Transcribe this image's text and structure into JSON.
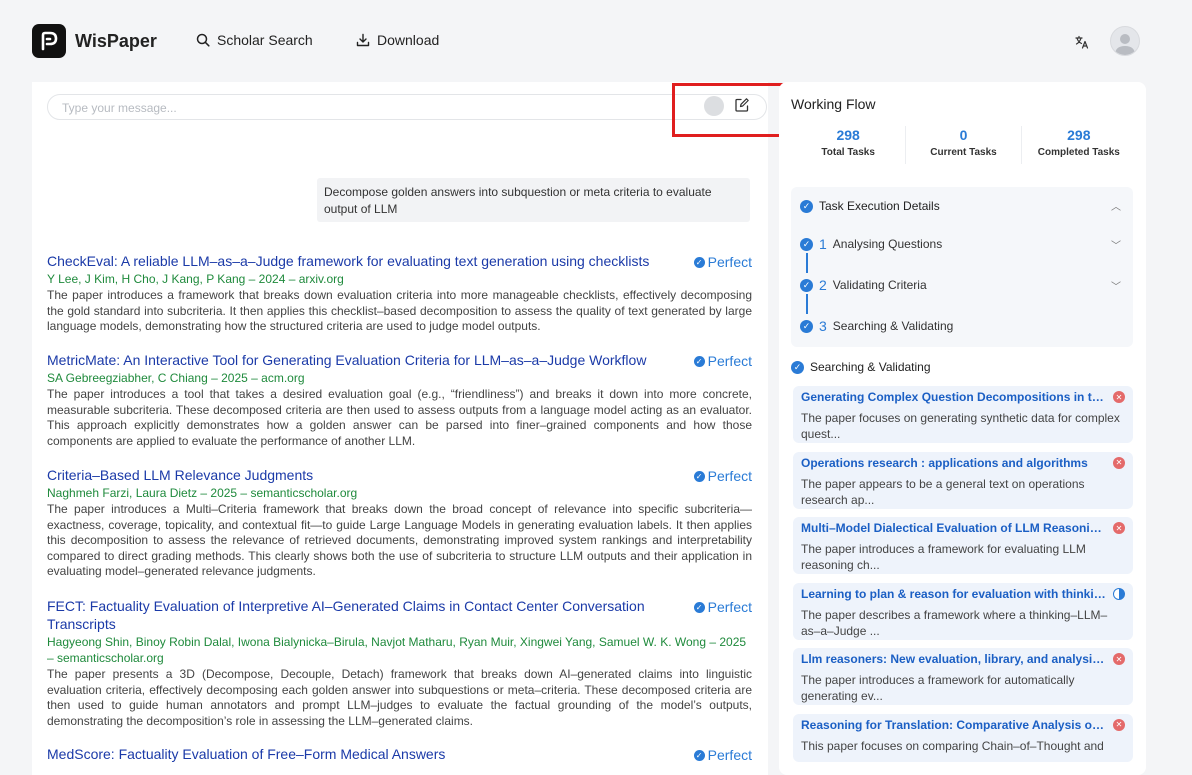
{
  "header": {
    "app_name": "WisPaper",
    "nav": [
      {
        "label": "Scholar Search",
        "icon": "search-icon"
      },
      {
        "label": "Download",
        "icon": "download-icon"
      }
    ],
    "translate_icon": "translate-icon",
    "avatar_icon": "user-avatar-icon"
  },
  "chat": {
    "input_placeholder": "Type your message...",
    "input_value": "",
    "query": "Decompose golden answers into subquestion or meta criteria to evaluate output of LLM"
  },
  "results": [
    {
      "title": "CheckEval: A reliable LLM–as–a–Judge framework for evaluating text generation using checklists",
      "meta": "Y Lee, J Kim, H Cho, J Kang, P Kang – 2024 – arxiv.org",
      "abstract": "The paper introduces a framework that breaks down evaluation criteria into more manageable checklists, effectively decomposing the gold standard into subcriteria. It then applies this checklist–based decomposition to assess the quality of text generated by large language models, demonstrating how the structured criteria are used to judge model outputs.",
      "badge": "Perfect"
    },
    {
      "title": "MetricMate: An Interactive Tool for Generating Evaluation Criteria for LLM–as–a–Judge Workflow",
      "meta": "SA Gebreegziabher, C Chiang – 2025 – acm.org",
      "abstract": "The paper introduces a tool that takes a desired evaluation goal (e.g., “friendliness”) and breaks it down into more concrete, measurable subcriteria. These decomposed criteria are then used to assess outputs from a language model acting as an evaluator. This approach explicitly demonstrates how a golden answer can be parsed into finer–grained components and how those components are applied to evaluate the performance of another LLM.",
      "badge": "Perfect"
    },
    {
      "title": "Criteria–Based LLM Relevance Judgments",
      "meta": "Naghmeh Farzi, Laura Dietz – 2025 – semanticscholar.org",
      "abstract": "The paper introduces a Multi–Criteria framework that breaks down the broad concept of relevance into specific subcriteria—exactness, coverage, topicality, and contextual fit—to guide Large Language Models in generating evaluation labels. It then applies this decomposition to assess the relevance of retrieved documents, demonstrating improved system rankings and interpretability compared to direct grading methods. This clearly shows both the use of subcriteria to structure LLM outputs and their application in evaluating model–generated relevance judgments.",
      "badge": "Perfect"
    },
    {
      "title": "FECT: Factuality Evaluation of Interpretive AI–Generated Claims in Contact Center Conversation Transcripts",
      "meta": "Hagyeong Shin, Binoy Robin Dalal, Iwona Bialynicka–Birula, Navjot Matharu, Ryan Muir, Xingwei Yang, Samuel W. K. Wong – 2025 – semanticscholar.org",
      "abstract": "The paper presents a 3D (Decompose, Decouple, Detach) framework that breaks down AI–generated claims into linguistic evaluation criteria, effectively decomposing each golden answer into subquestions or meta–criteria. These decomposed criteria are then used to guide human annotators and prompt LLM–judges to evaluate the factual grounding of the model’s outputs, demonstrating the decomposition’s role in assessing the LLM–generated claims.",
      "badge": "Perfect"
    },
    {
      "title": "MedScore: Factuality Evaluation of Free–Form Medical Answers",
      "meta": "",
      "abstract": "",
      "badge": "Perfect"
    }
  ],
  "workflow": {
    "title": "Working Flow",
    "stats": [
      {
        "value": "298",
        "label": "Total Tasks"
      },
      {
        "value": "0",
        "label": "Current Tasks"
      },
      {
        "value": "298",
        "label": "Completed Tasks"
      }
    ],
    "details_title": "Task Execution Details",
    "steps": [
      {
        "num": "1",
        "label": "Analysing Questions"
      },
      {
        "num": "2",
        "label": "Validating Criteria"
      },
      {
        "num": "3",
        "label": "Searching & Validating"
      }
    ],
    "section_title": "Searching & Validating",
    "papers": [
      {
        "title": "Generating Complex Question Decompositions in the Face of Distribution Shifts",
        "desc": "The paper focuses on generating synthetic data for complex quest...",
        "status": "rejected"
      },
      {
        "title": "Operations research : applications and algorithms",
        "desc": "The paper appears to be a general text on operations research ap...",
        "status": "rejected"
      },
      {
        "title": "Multi–Model Dialectical Evaluation of LLM Reasoning Chains",
        "desc": "The paper introduces a framework for evaluating LLM reasoning ch...",
        "status": "rejected"
      },
      {
        "title": "Learning to plan & reason for evaluation with thinking–llm–as–a–judge",
        "desc": "The paper describes a framework where a thinking–LLM–as–a–Judge ...",
        "status": "partial"
      },
      {
        "title": "Llm reasoners: New evaluation, library, and analysis of step–by–step reasoning",
        "desc": "The paper introduces a framework for automatically generating ev...",
        "status": "rejected"
      },
      {
        "title": "Reasoning for Translation: Comparative Analysis of Chain–of–Thought",
        "desc": "This paper focuses on comparing Chain–of–Thought and",
        "status": "rejected"
      }
    ]
  }
}
